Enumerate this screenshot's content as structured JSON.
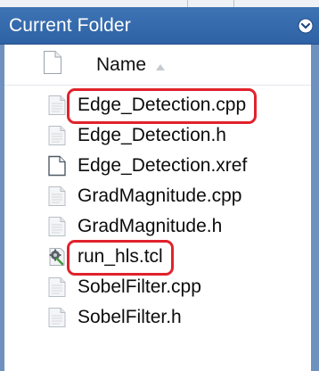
{
  "panel": {
    "title": "Current Folder",
    "menu_icon": "circle-chevron-down-icon",
    "header_color": "#3468aa",
    "highlight_color": "#e0222b"
  },
  "column": {
    "name_label": "Name",
    "sort_icon": "sort-ascending-icon",
    "file_icon": "blank-file-icon"
  },
  "files": [
    {
      "name": "Edge_Detection.cpp",
      "icon": "text-file-icon",
      "highlighted": true
    },
    {
      "name": "Edge_Detection.h",
      "icon": "text-file-icon",
      "highlighted": false
    },
    {
      "name": "Edge_Detection.xref",
      "icon": "blank-file-icon",
      "highlighted": false
    },
    {
      "name": "GradMagnitude.cpp",
      "icon": "text-file-icon",
      "highlighted": false
    },
    {
      "name": "GradMagnitude.h",
      "icon": "text-file-icon",
      "highlighted": false
    },
    {
      "name": "run_hls.tcl",
      "icon": "script-file-icon",
      "highlighted": true
    },
    {
      "name": "SobelFilter.cpp",
      "icon": "text-file-icon",
      "highlighted": false
    },
    {
      "name": "SobelFilter.h",
      "icon": "text-file-icon",
      "highlighted": false
    }
  ]
}
